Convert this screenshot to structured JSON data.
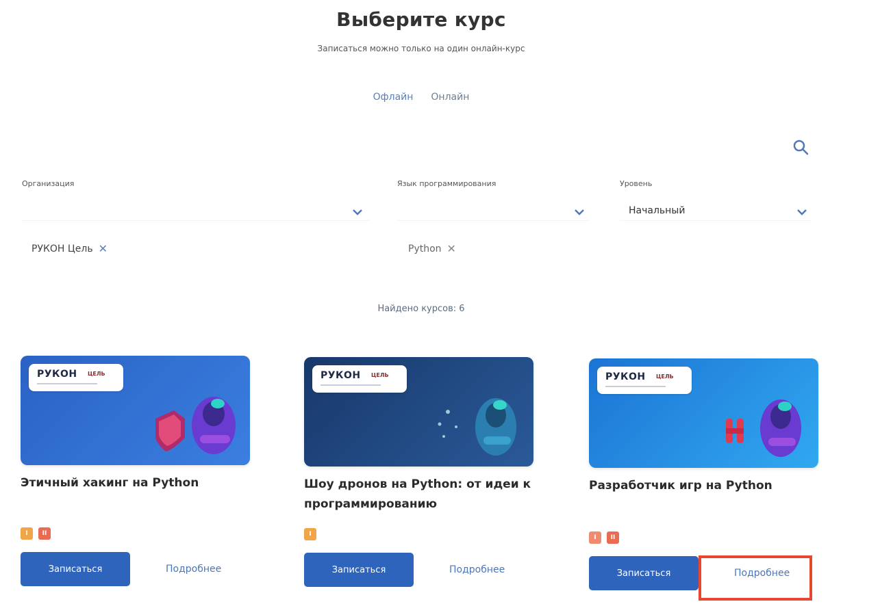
{
  "page": {
    "title": "Выберите курс",
    "subtitle": "Записаться можно только на один онлайн-курс"
  },
  "tabs": [
    {
      "label": "Офлайн"
    },
    {
      "label": "Онлайн"
    }
  ],
  "filters": {
    "organization": {
      "label": "Организация",
      "chip": "РУКОН Цель"
    },
    "language": {
      "label": "Язык программирования",
      "chip": "Python"
    },
    "level": {
      "label": "Уровень",
      "value": "Начальный"
    }
  },
  "results": {
    "found_text": "Найдено курсов: 6"
  },
  "courses": [
    {
      "title": "Этичный хакинг на Python",
      "badges": [
        "I",
        "II"
      ],
      "logo": "РУКОН",
      "logo_sub": "ЦЕЛЬ",
      "enroll_label": "Записаться",
      "more_label": "Подробнее",
      "image_colors": [
        "#2a62c4",
        "#3a7fe0"
      ]
    },
    {
      "title": "Шоу дронов на Python: от идеи к программированию",
      "badges": [
        "I"
      ],
      "logo": "РУКОН",
      "logo_sub": "ЦЕЛЬ",
      "enroll_label": "Записаться",
      "more_label": "Подробнее",
      "image_colors": [
        "#18386b",
        "#2a5a98"
      ]
    },
    {
      "title": "Разработчик игр на Python",
      "badges": [
        "I",
        "II"
      ],
      "logo": "РУКОН",
      "logo_sub": "ЦЕЛЬ",
      "enroll_label": "Записаться",
      "more_label": "Подробнее",
      "image_colors": [
        "#1c74d4",
        "#31a8f0"
      ]
    }
  ],
  "colors": {
    "accent": "#2f64bd",
    "link": "#4c76b8",
    "highlight": "#e8472f"
  }
}
